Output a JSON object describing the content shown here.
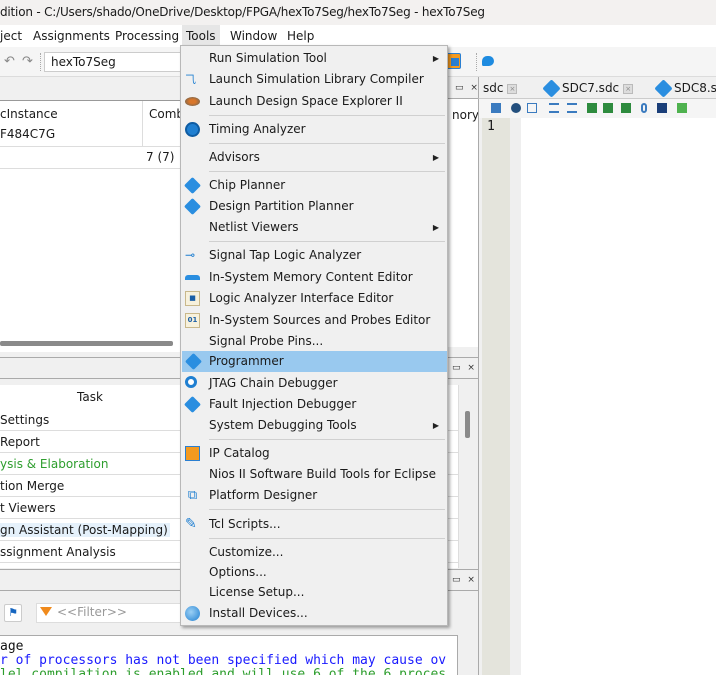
{
  "window": {
    "title": "dition - C:/Users/shado/OneDrive/Desktop/FPGA/hexTo7Seg/hexTo7Seg - hexTo7Seg"
  },
  "menubar": {
    "items": [
      "ject",
      "Assignments",
      "Processing",
      "Tools",
      "Window",
      "Help"
    ],
    "active": "Tools"
  },
  "toolbar": {
    "project_combo": "hexTo7Seg"
  },
  "project_navigator": {
    "columns": [
      "cInstance",
      "Comb"
    ],
    "device_value": "F484C7G",
    "row_value": "7 (7)"
  },
  "mid_panel": {
    "partial_header": "nory"
  },
  "editor": {
    "tabs": [
      {
        "label": "sdc",
        "icon": "abc-file-icon"
      },
      {
        "label": "SDC7.sdc",
        "icon": "abc-file-icon"
      },
      {
        "label": "SDC8.s",
        "icon": "abc-file-icon"
      }
    ],
    "line_numbers": [
      "1"
    ]
  },
  "tasks": {
    "column_header": "Task",
    "rows": [
      {
        "label": "Settings",
        "style": "normal"
      },
      {
        "label": "Report",
        "style": "normal"
      },
      {
        "label": "ysis & Elaboration",
        "style": "green"
      },
      {
        "label": "tion Merge",
        "style": "normal"
      },
      {
        "label": "t Viewers",
        "style": "normal"
      },
      {
        "label": "gn Assistant (Post-Mapping)",
        "style": "selected"
      },
      {
        "label": "ssignment Analysis",
        "style": "normal"
      }
    ]
  },
  "messages": {
    "filter_placeholder": "<<Filter>>",
    "column_header": "age",
    "lines": [
      {
        "text": "r of processors has not been specified which may cause ov",
        "color": "#1a1aff"
      },
      {
        "text": "lel compilation is enabled and will use 6 of the 6 proces",
        "color": "#2e9e2e"
      }
    ]
  },
  "tools_menu": {
    "items": [
      {
        "label": "Run Simulation Tool",
        "icon": "",
        "submenu": true
      },
      {
        "label": "Launch Simulation Library Compiler",
        "icon": "simulation-compiler-icon",
        "submenu": false
      },
      {
        "label": "Launch Design Space Explorer II",
        "icon": "design-space-explorer-icon",
        "submenu": false
      },
      {
        "separator": true
      },
      {
        "label": "Timing Analyzer",
        "icon": "timing-analyzer-icon",
        "submenu": false
      },
      {
        "separator": true
      },
      {
        "label": "Advisors",
        "icon": "",
        "submenu": true
      },
      {
        "separator": true
      },
      {
        "label": "Chip Planner",
        "icon": "chip-planner-icon",
        "submenu": false
      },
      {
        "label": "Design Partition Planner",
        "icon": "design-partition-planner-icon",
        "submenu": false
      },
      {
        "label": "Netlist Viewers",
        "icon": "",
        "submenu": true
      },
      {
        "separator": true
      },
      {
        "label": "Signal Tap Logic Analyzer",
        "icon": "signal-tap-icon",
        "submenu": false
      },
      {
        "label": "In-System Memory Content Editor",
        "icon": "memory-editor-icon",
        "submenu": false
      },
      {
        "label": "Logic Analyzer Interface Editor",
        "icon": "logic-analyzer-interface-icon",
        "submenu": false
      },
      {
        "label": "In-System Sources and Probes Editor",
        "icon": "sources-probes-icon",
        "submenu": false
      },
      {
        "label": "Signal Probe Pins...",
        "icon": "",
        "submenu": false
      },
      {
        "label": "Programmer",
        "icon": "programmer-icon",
        "submenu": false,
        "highlighted": true
      },
      {
        "label": "JTAG Chain Debugger",
        "icon": "jtag-debugger-icon",
        "submenu": false
      },
      {
        "label": "Fault Injection Debugger",
        "icon": "fault-injection-icon",
        "submenu": false
      },
      {
        "label": "System Debugging Tools",
        "icon": "",
        "submenu": true
      },
      {
        "separator": true
      },
      {
        "label": "IP Catalog",
        "icon": "ip-catalog-icon",
        "submenu": false
      },
      {
        "label": "Nios II Software Build Tools for Eclipse",
        "icon": "",
        "submenu": false
      },
      {
        "label": "Platform Designer",
        "icon": "platform-designer-icon",
        "submenu": false
      },
      {
        "separator": true
      },
      {
        "label": "Tcl Scripts...",
        "icon": "tcl-scripts-icon",
        "submenu": false
      },
      {
        "separator": true
      },
      {
        "label": "Customize...",
        "icon": "",
        "submenu": false
      },
      {
        "label": "Options...",
        "icon": "",
        "submenu": false
      },
      {
        "label": "License Setup...",
        "icon": "",
        "submenu": false
      },
      {
        "label": "Install Devices...",
        "icon": "install-devices-icon",
        "submenu": false
      }
    ],
    "highlight_color": "#99c9ef"
  }
}
